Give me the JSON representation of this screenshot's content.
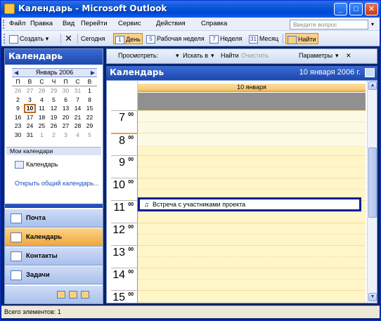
{
  "window": {
    "title": "Календарь - Microsoft Outlook"
  },
  "titlebar_buttons": {
    "minimize": "_",
    "maximize": "□",
    "close": "✕"
  },
  "menu": {
    "items": [
      "Файл",
      "Правка",
      "Вид",
      "Перейти",
      "Сервис",
      "Действия",
      "Справка"
    ],
    "ask_placeholder": "Введите вопрос",
    "ask_arrow": "▾"
  },
  "toolbar": {
    "create": "Создать",
    "create_arrow": "▾",
    "delete_glyph": "✕",
    "today": "Сегодня",
    "day": "День",
    "day_num": "1",
    "workweek": "Рабочая неделя",
    "workweek_num": "5",
    "week": "Неделя",
    "week_num": "7",
    "month": "Месяц",
    "month_num": "31",
    "find": "Найти"
  },
  "nav": {
    "header": "Календарь",
    "minical": {
      "month": "Январь 2006",
      "prev": "◀",
      "next": "▶",
      "dows": [
        "П",
        "В",
        "С",
        "Ч",
        "П",
        "С",
        "В"
      ],
      "days": [
        [
          "26",
          "other"
        ],
        [
          "27",
          "other"
        ],
        [
          "28",
          "other"
        ],
        [
          "29",
          "other"
        ],
        [
          "30",
          "other"
        ],
        [
          "31",
          "other"
        ],
        [
          "1",
          ""
        ],
        [
          "2",
          ""
        ],
        [
          "3",
          ""
        ],
        [
          "4",
          ""
        ],
        [
          "5",
          ""
        ],
        [
          "6",
          ""
        ],
        [
          "7",
          ""
        ],
        [
          "8",
          ""
        ],
        [
          "9",
          ""
        ],
        [
          "10",
          "today"
        ],
        [
          "11",
          ""
        ],
        [
          "12",
          ""
        ],
        [
          "13",
          ""
        ],
        [
          "14",
          ""
        ],
        [
          "15",
          ""
        ],
        [
          "16",
          ""
        ],
        [
          "17",
          ""
        ],
        [
          "18",
          ""
        ],
        [
          "19",
          ""
        ],
        [
          "20",
          ""
        ],
        [
          "21",
          ""
        ],
        [
          "22",
          ""
        ],
        [
          "23",
          ""
        ],
        [
          "24",
          ""
        ],
        [
          "25",
          ""
        ],
        [
          "26",
          ""
        ],
        [
          "27",
          ""
        ],
        [
          "28",
          ""
        ],
        [
          "29",
          ""
        ],
        [
          "30",
          ""
        ],
        [
          "31",
          ""
        ],
        [
          "1",
          "other"
        ],
        [
          "2",
          "other"
        ],
        [
          "3",
          "other"
        ],
        [
          "4",
          "other"
        ],
        [
          "5",
          "other"
        ]
      ]
    },
    "my_calendars": "Мои календари",
    "calendar_item": "Календарь",
    "open_shared": "Открыть общий календарь...",
    "buttons": {
      "mail": "Почта",
      "calendar": "Календарь",
      "contacts": "Контакты",
      "tasks": "Задачи"
    }
  },
  "view_toolbar": {
    "view": "Просмотреть:",
    "view_arrow": "▾",
    "search_in": "Искать в",
    "search_arrow": "▾",
    "find": "Найти",
    "clear": "Очистить",
    "options": "Параметры",
    "options_arrow": "▾",
    "close": "✕"
  },
  "calendar": {
    "title": "Календарь",
    "date": "10 января 2006 г.",
    "day_label": "10 января",
    "hours": [
      {
        "h": "7",
        "m": "00"
      },
      {
        "h": "8",
        "m": "00"
      },
      {
        "h": "9",
        "m": "00"
      },
      {
        "h": "10",
        "m": "00"
      },
      {
        "h": "11",
        "m": "00"
      },
      {
        "h": "12",
        "m": "00"
      },
      {
        "h": "13",
        "m": "00"
      },
      {
        "h": "14",
        "m": "00"
      },
      {
        "h": "15",
        "m": "00"
      }
    ],
    "appointment": "Встреча с участниками проекта",
    "appointment_icon": "♫",
    "scroll_up": "▲",
    "scroll_down": "▼"
  },
  "status": {
    "text": "Всего элементов: 1"
  },
  "colors": {
    "titlebar": "#0046d5",
    "nav_active": "#f0a63c",
    "work_hours": "#fef5c8",
    "appointment_border": "#0a1f8f"
  }
}
